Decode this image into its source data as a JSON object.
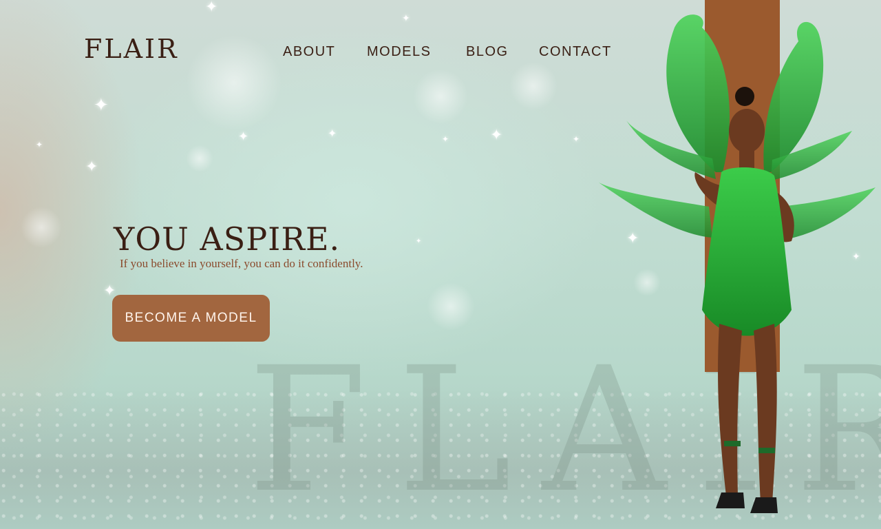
{
  "brand": {
    "logo_text": "FLAIR",
    "watermark_text": "FLAIR"
  },
  "nav": {
    "items": [
      {
        "label": "ABOUT"
      },
      {
        "label": "MODELS"
      },
      {
        "label": "BLOG"
      },
      {
        "label": "CONTACT"
      }
    ]
  },
  "hero": {
    "title": "YOU ASPIRE.",
    "subtitle": "If you believe in yourself, you can do it confidently.",
    "cta_label": "BECOME A MODEL"
  },
  "colors": {
    "text_dark": "#3a1f14",
    "accent_brown": "#a2663f",
    "subtitle_brown": "#8a4a2c",
    "background_mint": "#c2ddd2",
    "costume_green": "#2fae3f"
  }
}
